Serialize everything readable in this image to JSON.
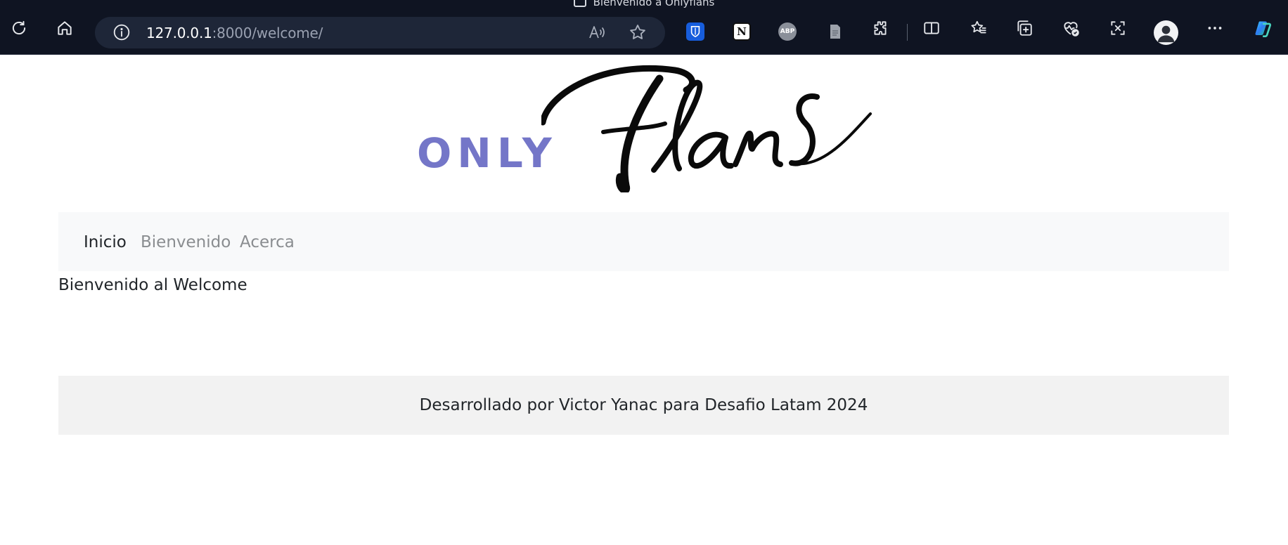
{
  "browser": {
    "window_title": "Bienvenido a Onlyflans",
    "address": {
      "host": "127.0.0.1",
      "path": ":8000/welcome/"
    },
    "toolbar_icons": [
      "reload-icon",
      "home-icon",
      "info-icon",
      "read-aloud-icon",
      "favorite-star-icon",
      "bitwarden-icon",
      "notion-icon",
      "adblock-plus-icon",
      "document-icon",
      "extensions-icon",
      "split-screen-icon",
      "favorites-icon",
      "collections-icon",
      "browser-essentials-icon",
      "screenshot-icon",
      "profile-icon",
      "more-icon",
      "copilot-icon"
    ],
    "extensions": {
      "adblock_label": "ABP"
    }
  },
  "logo": {
    "only_text": "ONLY",
    "script_text": "Flans",
    "only_color": "#7476c8"
  },
  "nav": {
    "items": [
      {
        "label": "Inicio",
        "active": true
      },
      {
        "label": "Bienvenido",
        "active": false
      },
      {
        "label": "Acerca",
        "active": false
      }
    ]
  },
  "main": {
    "text": "Bienvenido al Welcome"
  },
  "footer": {
    "text": "Desarrollado por Victor Yanac para Desafio Latam 2024"
  }
}
